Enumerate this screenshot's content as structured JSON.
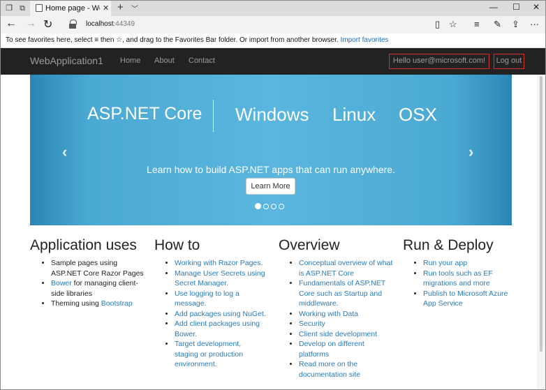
{
  "browser": {
    "tab_title": "Home page - WebAppli",
    "url_host": "localhost",
    "url_port": ":44349",
    "favorites_text": "To see favorites here, select",
    "favorites_text2": "then ☆, and drag to the Favorites Bar folder. Or import from another browser.",
    "import_link": "Import favorites"
  },
  "navbar": {
    "brand": "WebApplication1",
    "links": [
      "Home",
      "About",
      "Contact"
    ],
    "hello": "Hello user@microsoft.com!",
    "logout": "Log out"
  },
  "carousel": {
    "title_main": "ASP.NET Core",
    "title_windows": "Windows",
    "title_linux": "Linux",
    "title_osx": "OSX",
    "caption": "Learn how to build ASP.NET apps that can run anywhere.",
    "button": "Learn More",
    "slide_count": 4,
    "active_slide": 1
  },
  "columns": {
    "app": {
      "heading": "Application uses",
      "item1": "Sample pages using ASP.NET Core Razor Pages",
      "item2_link": "Bower",
      "item2_rest": " for managing client-side libraries",
      "item3_text": "Theming using ",
      "item3_link": "Bootstrap"
    },
    "howto": {
      "heading": "How to",
      "items": [
        "Working with Razor Pages.",
        "Manage User Secrets using Secret Manager.",
        "Use logging to log a message.",
        "Add packages using NuGet.",
        "Add client packages using Bower.",
        "Target development, staging or production environment."
      ]
    },
    "overview": {
      "heading": "Overview",
      "items": [
        "Conceptual overview of what is ASP.NET Core",
        "Fundamentals of ASP.NET Core such as Startup and middleware.",
        "Working with Data",
        "Security",
        "Client side development",
        "Develop on different platforms",
        "Read more on the documentation site"
      ]
    },
    "deploy": {
      "heading": "Run & Deploy",
      "items": [
        "Run your app",
        "Run tools such as EF migrations and more",
        "Publish to Microsoft Azure App Service"
      ]
    }
  }
}
